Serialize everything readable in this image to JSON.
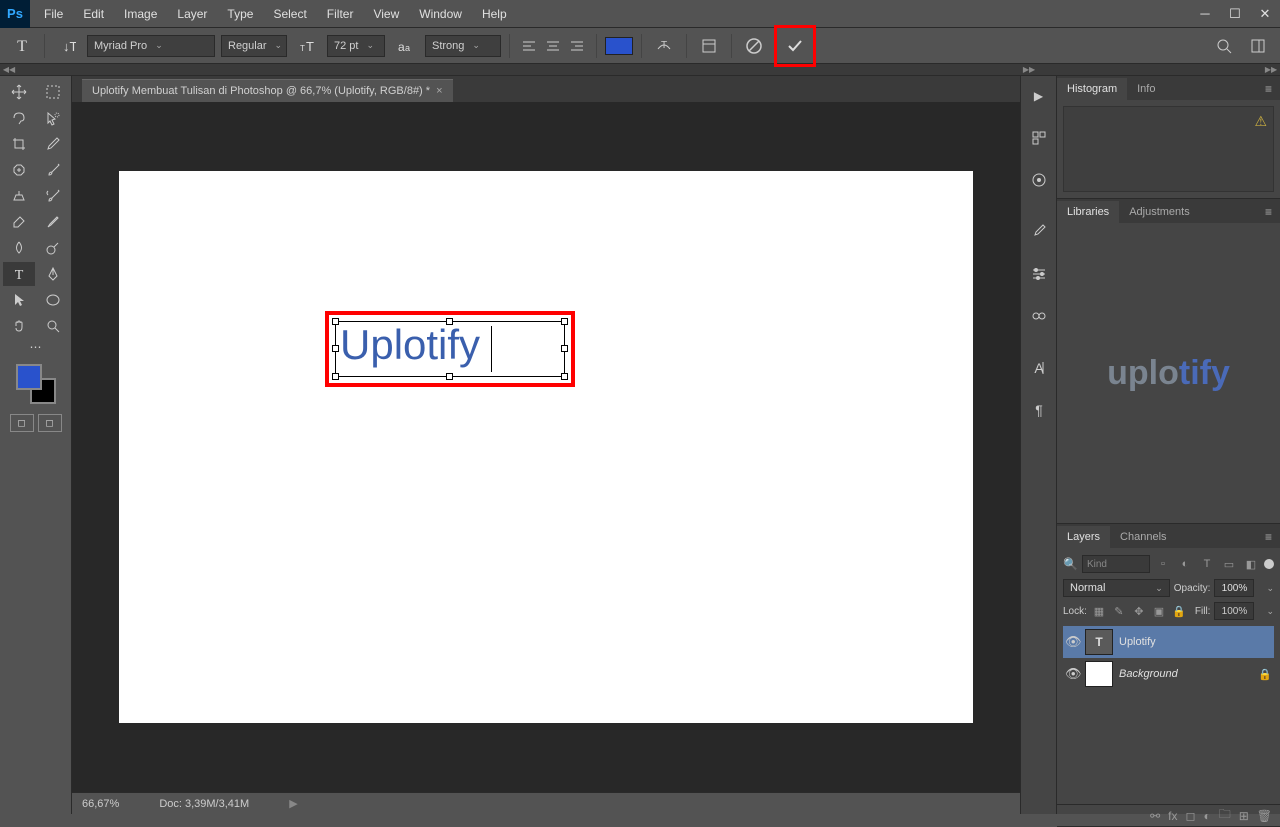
{
  "app": {
    "logo": "Ps"
  },
  "menu": [
    "File",
    "Edit",
    "Image",
    "Layer",
    "Type",
    "Select",
    "Filter",
    "View",
    "Window",
    "Help"
  ],
  "options": {
    "font_family": "Myriad Pro",
    "font_style": "Regular",
    "font_size": "72 pt",
    "antialias": "Strong",
    "text_color": "#2952cc"
  },
  "tab": {
    "title": "Uplotify Membuat Tulisan di Photoshop @ 66,7% (Uplotify, RGB/8#) *"
  },
  "canvas": {
    "text": "Uplotify"
  },
  "status": {
    "zoom": "66,67%",
    "doc": "Doc: 3,39M/3,41M"
  },
  "panels": {
    "histogram_tabs": [
      "Histogram",
      "Info"
    ],
    "lib_tabs": [
      "Libraries",
      "Adjustments"
    ],
    "lib_logo_1": "uplo",
    "lib_logo_2": "tify",
    "layer_tabs": [
      "Layers",
      "Channels"
    ],
    "filter_placeholder": "Kind",
    "blend_mode": "Normal",
    "opacity_label": "Opacity:",
    "opacity_value": "100%",
    "lock_label": "Lock:",
    "fill_label": "Fill:",
    "fill_value": "100%",
    "layers": [
      {
        "name": "Uplotify",
        "type": "text",
        "selected": true
      },
      {
        "name": "Background",
        "type": "raster",
        "locked": true
      }
    ]
  }
}
